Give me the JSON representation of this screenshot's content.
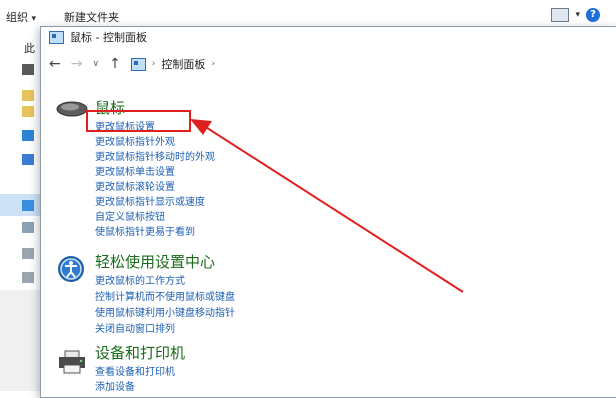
{
  "explorer": {
    "organize": "组织",
    "new_folder": "新建文件夹",
    "nav_root": "此"
  },
  "window": {
    "title": "鼠标 - 控制面板",
    "breadcrumb": "控制面板"
  },
  "sections": [
    {
      "title": "鼠标",
      "icon": "mouse-icon",
      "links": [
        "更改鼠标设置",
        "更改鼠标指针外观",
        "更改鼠标指针移动时的外观",
        "更改鼠标单击设置",
        "更改鼠标滚轮设置",
        "更改鼠标指针显示或速度",
        "自定义鼠标按钮",
        "使鼠标指针更易于看到"
      ]
    },
    {
      "title": "轻松使用设置中心",
      "icon": "ease-of-access-icon",
      "links": [
        "更改鼠标的工作方式",
        "控制计算机而不使用鼠标或键盘",
        "使用鼠标键利用小键盘移动指针",
        "关闭自动窗口排列"
      ]
    },
    {
      "title": "设备和打印机",
      "icon": "printer-icon",
      "links": [
        "查看设备和打印机",
        "添加设备"
      ]
    }
  ],
  "colors": {
    "section_title": "#1a6b1a",
    "link": "#1c5fb6",
    "annotation": "#e02020"
  }
}
